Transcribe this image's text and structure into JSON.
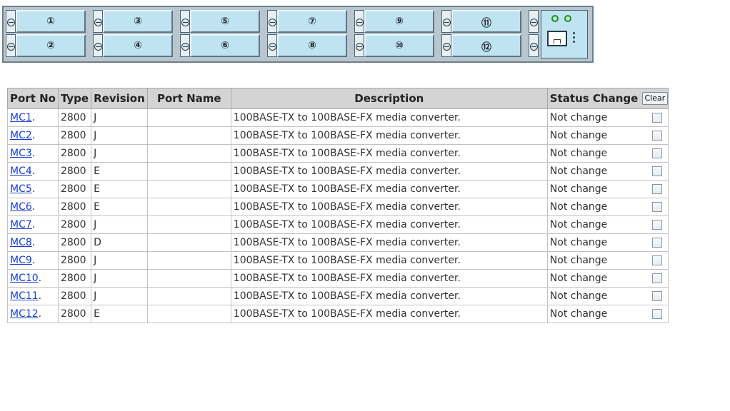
{
  "chassis": {
    "slots_top": [
      "①",
      "③",
      "⑤",
      "⑦",
      "⑨",
      "⑪"
    ],
    "slots_bottom": [
      "②",
      "④",
      "⑥",
      "⑧",
      "⑩",
      "⑫"
    ],
    "colors": {
      "panel": "#b9c6cf",
      "slot": "#bfe3f1",
      "led": "#1c8c2e"
    }
  },
  "table": {
    "headers": {
      "port_no": "Port No",
      "type": "Type",
      "revision": "Revision",
      "port_name": "Port Name",
      "description": "Description",
      "status_change": "Status Change",
      "clear_button": "Clear"
    },
    "rows": [
      {
        "port": "MC1",
        "type": "2800",
        "revision": "J",
        "port_name": "",
        "description": "100BASE-TX to 100BASE-FX media converter.",
        "status": "Not change"
      },
      {
        "port": "MC2",
        "type": "2800",
        "revision": "J",
        "port_name": "",
        "description": "100BASE-TX to 100BASE-FX media converter.",
        "status": "Not change"
      },
      {
        "port": "MC3",
        "type": "2800",
        "revision": "J",
        "port_name": "",
        "description": "100BASE-TX to 100BASE-FX media converter.",
        "status": "Not change"
      },
      {
        "port": "MC4",
        "type": "2800",
        "revision": "E",
        "port_name": "",
        "description": "100BASE-TX to 100BASE-FX media converter.",
        "status": "Not change"
      },
      {
        "port": "MC5",
        "type": "2800",
        "revision": "E",
        "port_name": "",
        "description": "100BASE-TX to 100BASE-FX media converter.",
        "status": "Not change"
      },
      {
        "port": "MC6",
        "type": "2800",
        "revision": "E",
        "port_name": "",
        "description": "100BASE-TX to 100BASE-FX media converter.",
        "status": "Not change"
      },
      {
        "port": "MC7",
        "type": "2800",
        "revision": "J",
        "port_name": "",
        "description": "100BASE-TX to 100BASE-FX media converter.",
        "status": "Not change"
      },
      {
        "port": "MC8",
        "type": "2800",
        "revision": "D",
        "port_name": "",
        "description": "100BASE-TX to 100BASE-FX media converter.",
        "status": "Not change"
      },
      {
        "port": "MC9",
        "type": "2800",
        "revision": "J",
        "port_name": "",
        "description": "100BASE-TX to 100BASE-FX media converter.",
        "status": "Not change"
      },
      {
        "port": "MC10",
        "type": "2800",
        "revision": "J",
        "port_name": "",
        "description": "100BASE-TX to 100BASE-FX media converter.",
        "status": "Not change"
      },
      {
        "port": "MC11",
        "type": "2800",
        "revision": "J",
        "port_name": "",
        "description": "100BASE-TX to 100BASE-FX media converter.",
        "status": "Not change"
      },
      {
        "port": "MC12",
        "type": "2800",
        "revision": "E",
        "port_name": "",
        "description": "100BASE-TX to 100BASE-FX media converter.",
        "status": "Not change"
      }
    ]
  }
}
